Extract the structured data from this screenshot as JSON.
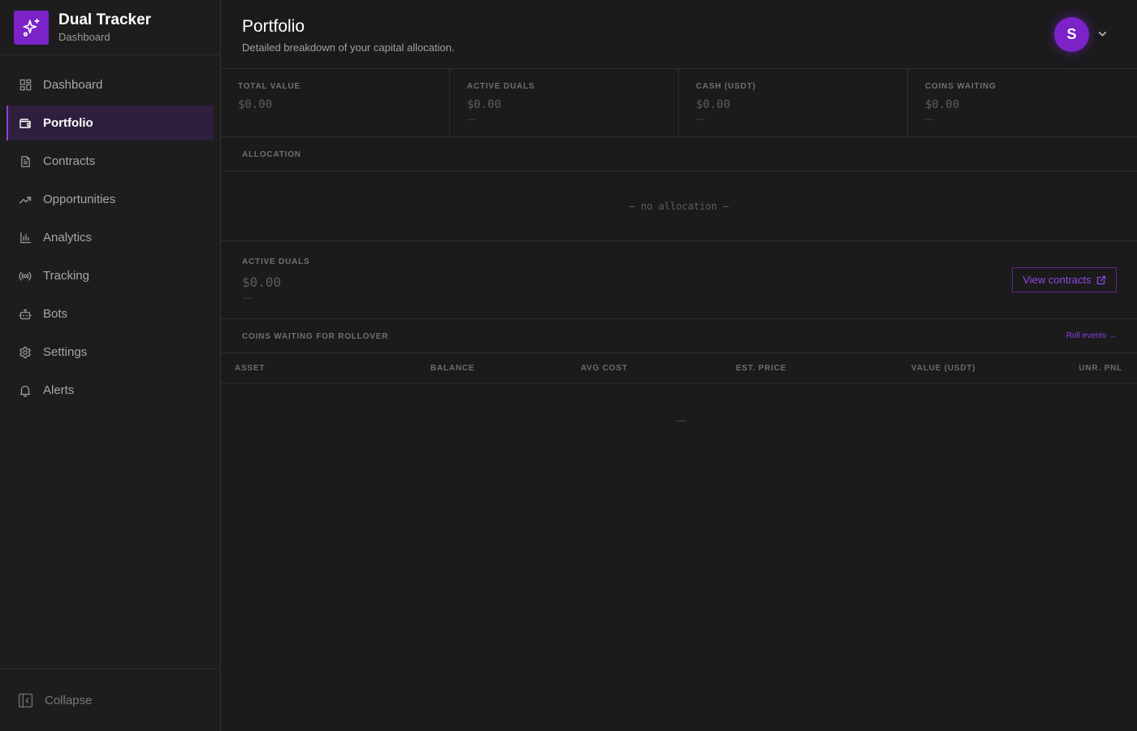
{
  "brand": {
    "title": "Dual Tracker",
    "subtitle": "Dashboard",
    "accent": "#7b22c9"
  },
  "nav": {
    "items": [
      {
        "label": "Dashboard",
        "icon": "grid-icon",
        "active": false
      },
      {
        "label": "Portfolio",
        "icon": "wallet-icon",
        "active": true
      },
      {
        "label": "Contracts",
        "icon": "document-icon",
        "active": false
      },
      {
        "label": "Opportunities",
        "icon": "trending-up-icon",
        "active": false
      },
      {
        "label": "Analytics",
        "icon": "bar-chart-icon",
        "active": false
      },
      {
        "label": "Tracking",
        "icon": "radio-icon",
        "active": false
      },
      {
        "label": "Bots",
        "icon": "bot-icon",
        "active": false
      },
      {
        "label": "Settings",
        "icon": "gear-icon",
        "active": false
      },
      {
        "label": "Alerts",
        "icon": "bell-icon",
        "active": false
      }
    ],
    "collapse_label": "Collapse"
  },
  "header": {
    "title": "Portfolio",
    "subtitle": "Detailed breakdown of your capital allocation.",
    "avatar_initial": "S"
  },
  "stats": [
    {
      "label": "TOTAL VALUE",
      "value": "$0.00",
      "sub": ""
    },
    {
      "label": "ACTIVE DUALS",
      "value": "$0.00",
      "sub": "—"
    },
    {
      "label": "CASH (USDT)",
      "value": "$0.00",
      "sub": "—"
    },
    {
      "label": "COINS WAITING",
      "value": "$0.00",
      "sub": "—"
    }
  ],
  "allocation": {
    "label": "ALLOCATION",
    "empty_text": "— no allocation —"
  },
  "active_duals": {
    "label": "ACTIVE DUALS",
    "value": "$0.00",
    "sub": "—",
    "button_label": "View contracts"
  },
  "rollover": {
    "label": "COINS WAITING FOR ROLLOVER",
    "link_label": "Roll events →",
    "columns": [
      "ASSET",
      "BALANCE",
      "AVG COST",
      "EST. PRICE",
      "VALUE (USDT)",
      "UNR. PNL"
    ],
    "empty_text": "—"
  }
}
